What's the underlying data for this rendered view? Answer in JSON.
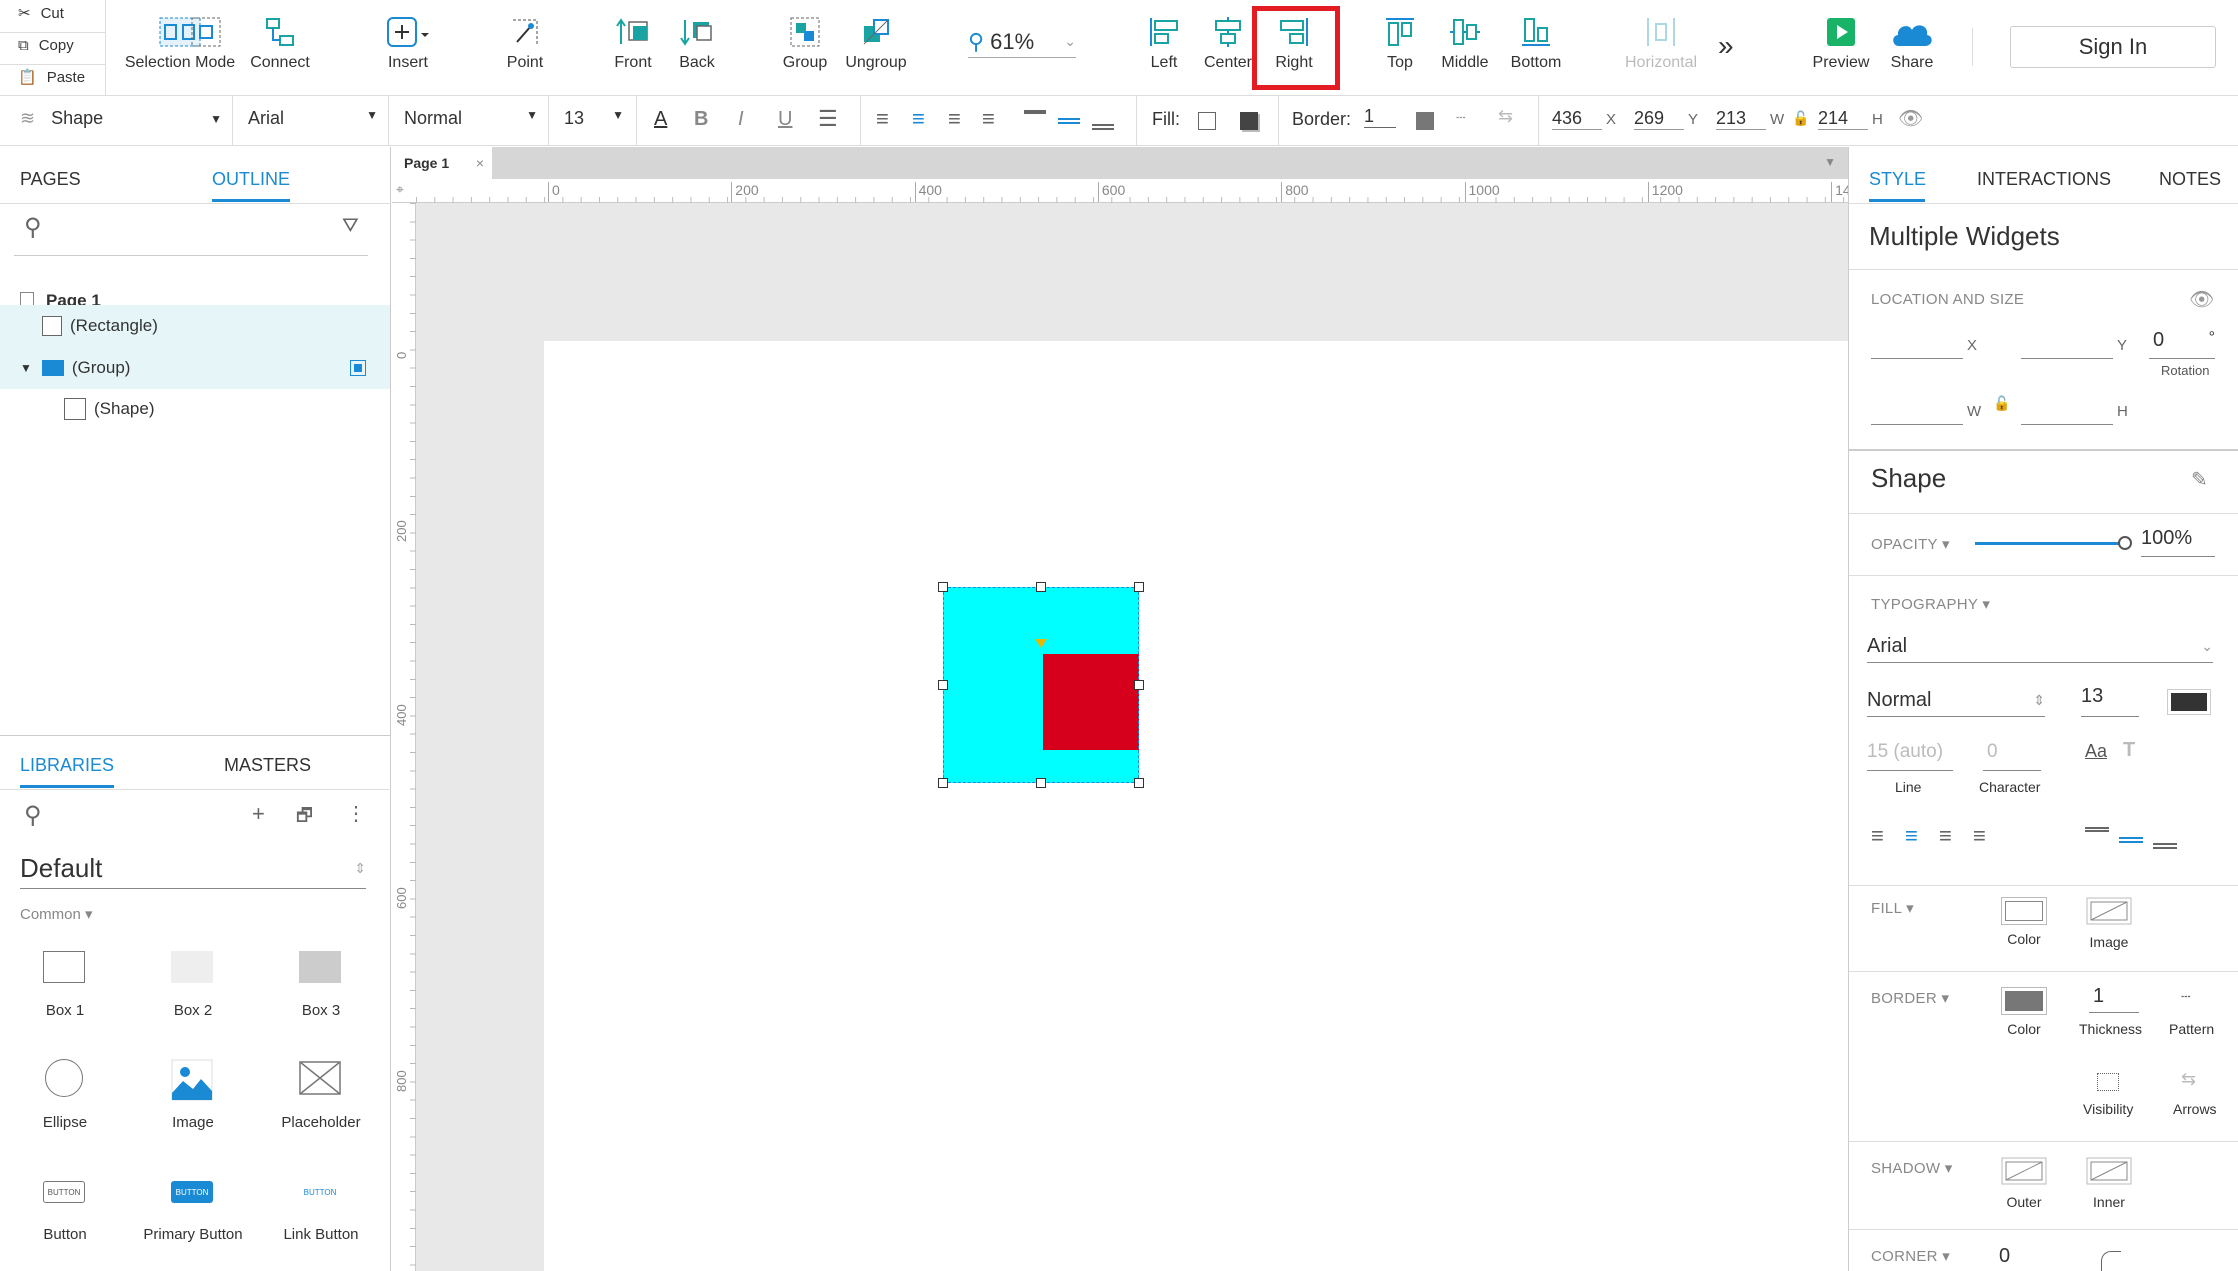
{
  "clipboard": {
    "cut": "Cut",
    "copy": "Copy",
    "paste": "Paste"
  },
  "toolbar": {
    "selection_mode": "Selection Mode",
    "connect": "Connect",
    "insert": "Insert",
    "point": "Point",
    "front": "Front",
    "back": "Back",
    "group": "Group",
    "ungroup": "Ungroup",
    "zoom": "61%",
    "left": "Left",
    "center": "Center",
    "right": "Right",
    "top": "Top",
    "middle": "Middle",
    "bottom": "Bottom",
    "horizontal": "Horizontal",
    "more": "»",
    "preview": "Preview",
    "share": "Share",
    "sign_in": "Sign In"
  },
  "format_bar": {
    "style": "Shape",
    "font": "Arial",
    "weight": "Normal",
    "size": "13",
    "fill_label": "Fill:",
    "border_label": "Border:",
    "border_value": "1",
    "x": "436",
    "x_label": "X",
    "y": "269",
    "y_label": "Y",
    "w": "213",
    "w_label": "W",
    "h": "214",
    "h_label": "H"
  },
  "left_panel": {
    "tab_pages": "PAGES",
    "tab_outline": "OUTLINE",
    "page": "Page 1",
    "items": [
      {
        "label": "(Rectangle)"
      },
      {
        "label": "(Group)"
      },
      {
        "label": "(Shape)"
      }
    ],
    "libraries_tab": "LIBRARIES",
    "masters_tab": "MASTERS",
    "library": "Default",
    "category": "Common ▾",
    "widgets": [
      {
        "label": "Box 1"
      },
      {
        "label": "Box 2"
      },
      {
        "label": "Box 3"
      },
      {
        "label": "Ellipse"
      },
      {
        "label": "Image"
      },
      {
        "label": "Placeholder"
      },
      {
        "label": "Button"
      },
      {
        "label": "Primary Button"
      },
      {
        "label": "Link Button"
      }
    ],
    "button_text": "BUTTON"
  },
  "canvas": {
    "tab": "Page 1",
    "ruler_h": [
      "0",
      "200",
      "400",
      "600",
      "800",
      "1000",
      "1200",
      "14"
    ],
    "ruler_v": [
      "0",
      "200",
      "400",
      "600",
      "800"
    ],
    "colors": {
      "outer": "#00ffff",
      "inner": "#d6001c"
    }
  },
  "right_panel": {
    "tab_style": "STYLE",
    "tab_interactions": "INTERACTIONS",
    "tab_notes": "NOTES",
    "title": "Multiple Widgets",
    "location_title": "LOCATION AND SIZE",
    "x_label": "X",
    "y_label": "Y",
    "rotation_value": "0",
    "degree": "°",
    "rotation_label": "Rotation",
    "w_label": "W",
    "h_label": "H",
    "shape_title": "Shape",
    "opacity_label": "OPACITY ▾",
    "opacity_value": "100%",
    "opacity_level": 1.0,
    "typography_label": "TYPOGRAPHY ▾",
    "font": "Arial",
    "weight": "Normal",
    "size": "13",
    "line_value": "15 (auto)",
    "line_label": "Line",
    "char_value": "0",
    "char_label": "Character",
    "fill_label": "FILL ▾",
    "fill_color": "Color",
    "fill_image": "Image",
    "border_label": "BORDER ▾",
    "border_color": "Color",
    "thickness_value": "1",
    "thickness_label": "Thickness",
    "pattern_label": "Pattern",
    "visibility_label": "Visibility",
    "arrows_label": "Arrows",
    "shadow_label": "SHADOW ▾",
    "outer_label": "Outer",
    "inner_label": "Inner",
    "corner_label": "CORNER ▾",
    "corner_value": "0"
  },
  "highlight_color": "#e31b23"
}
